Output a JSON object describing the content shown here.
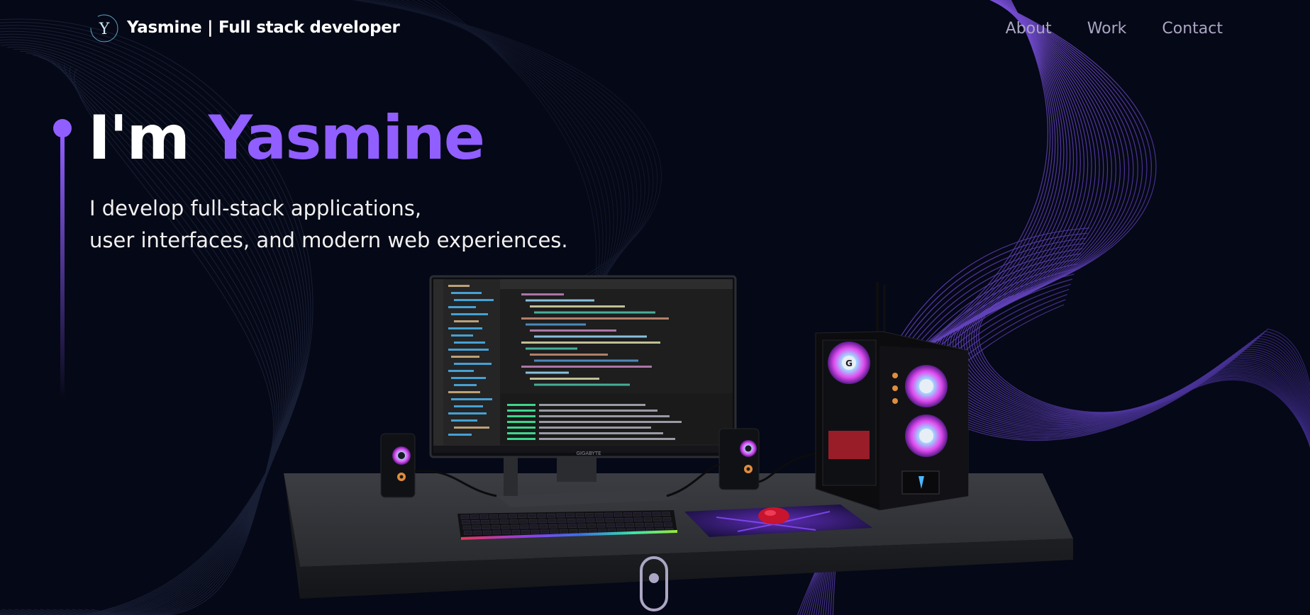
{
  "navbar": {
    "logo_letter": "Y",
    "brand": "Yasmine  | Full stack developer",
    "links": [
      "About",
      "Work",
      "Contact"
    ]
  },
  "hero": {
    "title_prefix": "I'm ",
    "title_name": "Yasmine",
    "subtitle_line1": "I develop full-stack applications,",
    "subtitle_line2": "user interfaces, and modern web experiences."
  },
  "monitor": {
    "brand": "GIGABYTE"
  },
  "colors": {
    "background": "#050816",
    "accent": "#915eff",
    "nav_text": "#aaa6c3",
    "text": "#ffffff"
  },
  "icons": {
    "logo": "y-circle-logo",
    "scroll": "mouse-scroll-indicator"
  }
}
